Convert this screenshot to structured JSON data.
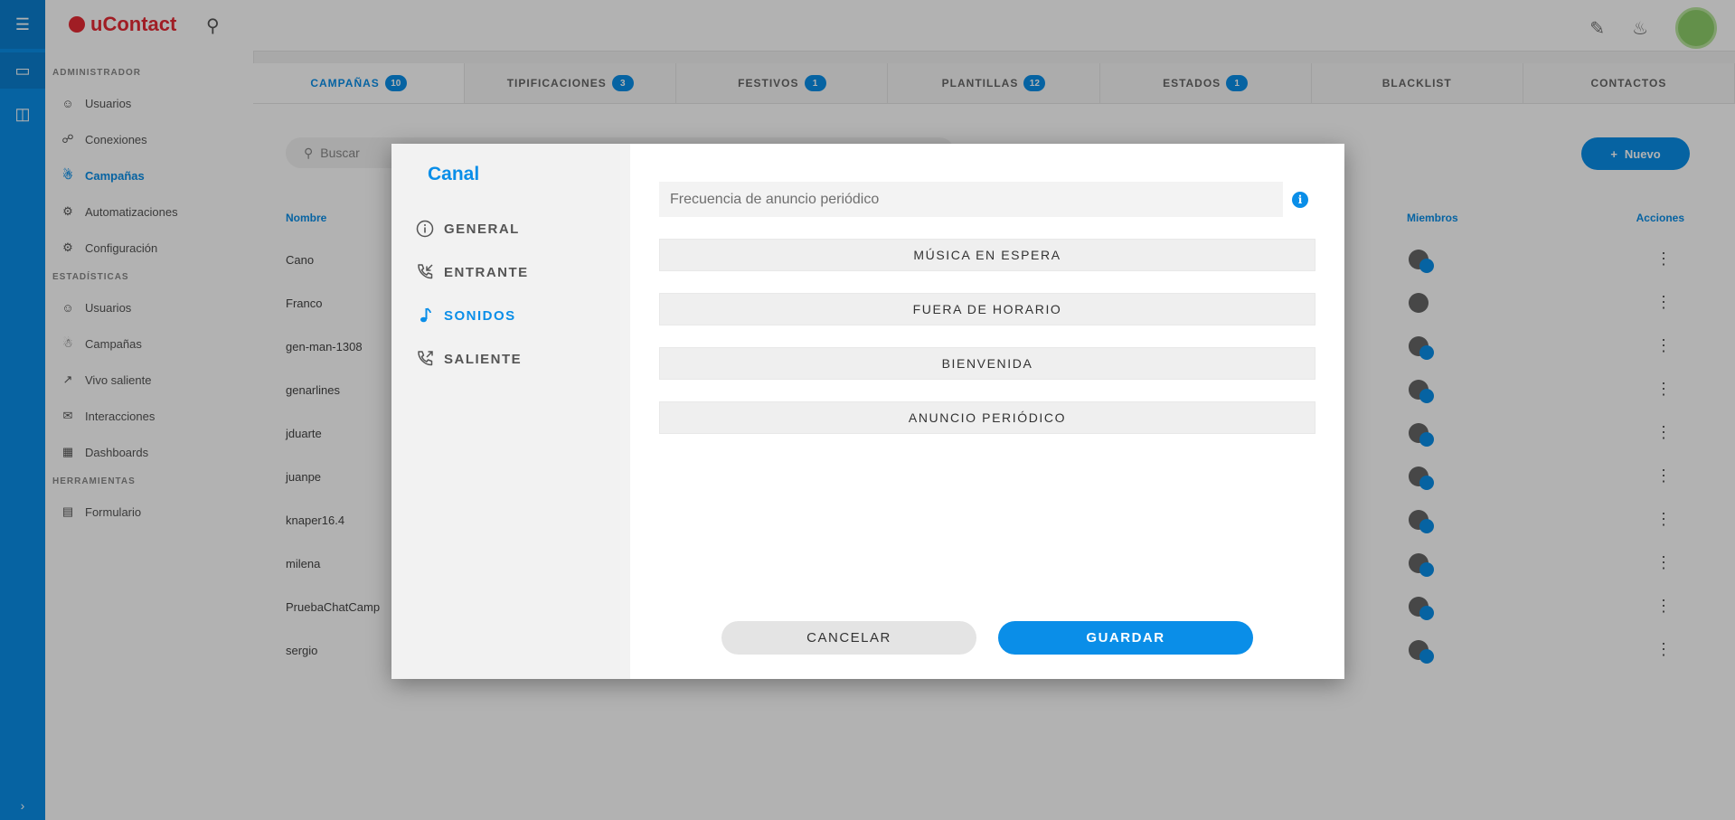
{
  "app": {
    "logo_text": "uContact",
    "rail": [
      "menu-icon",
      "monitor-icon",
      "inbox-icon"
    ],
    "rail_bottom": "expand-icon"
  },
  "sidebar": {
    "sections": [
      {
        "title": "ADMINISTRADOR",
        "items": [
          {
            "label": "Usuarios",
            "icon": "user-icon"
          },
          {
            "label": "Conexiones",
            "icon": "link-icon"
          },
          {
            "label": "Campañas",
            "icon": "campaign-icon",
            "active": true
          },
          {
            "label": "Automatizaciones",
            "icon": "automation-icon"
          },
          {
            "label": "Configuración",
            "icon": "settings-icon"
          }
        ]
      },
      {
        "title": "ESTADÍSTICAS",
        "items": [
          {
            "label": "Usuarios",
            "icon": "user-icon"
          },
          {
            "label": "Campañas",
            "icon": "campaign-icon"
          },
          {
            "label": "Vivo saliente",
            "icon": "outgoing-icon"
          },
          {
            "label": "Interacciones",
            "icon": "interactions-icon"
          },
          {
            "label": "Dashboards",
            "icon": "dashboard-icon"
          }
        ]
      },
      {
        "title": "HERRAMIENTAS",
        "items": [
          {
            "label": "Formulario",
            "icon": "form-icon"
          }
        ]
      }
    ]
  },
  "tabs": [
    {
      "label": "CAMPAÑAS",
      "badge": "10",
      "active": true
    },
    {
      "label": "TIPIFICACIONES",
      "badge": "3"
    },
    {
      "label": "FESTIVOS",
      "badge": "1"
    },
    {
      "label": "PLANTILLAS",
      "badge": "12"
    },
    {
      "label": "ESTADOS",
      "badge": "1"
    },
    {
      "label": "BLACKLIST",
      "badge": ""
    },
    {
      "label": "CONTACTOS",
      "badge": ""
    }
  ],
  "list": {
    "search_placeholder": "Buscar",
    "new_button": "Nuevo",
    "col_name": "Nombre",
    "col_members": "Miembros",
    "col_actions": "Acciones",
    "rows": [
      "Cano",
      "Franco",
      "gen-man-1308",
      "genarlines",
      "jduarte",
      "juanpe",
      "knaper16.4",
      "milena",
      "PruebaChatCamp",
      "sergio"
    ]
  },
  "dialog": {
    "title": "Canal",
    "menu": [
      {
        "label": "GENERAL",
        "icon": "info-circle-icon"
      },
      {
        "label": "ENTRANTE",
        "icon": "incoming-call-icon"
      },
      {
        "label": "SONIDOS",
        "icon": "music-note-icon",
        "active": true
      },
      {
        "label": "SALIENTE",
        "icon": "outgoing-call-icon"
      }
    ],
    "frequency": {
      "placeholder": "Frecuencia de anuncio periódico",
      "value": ""
    },
    "sound_buttons": [
      "MÚSICA EN ESPERA",
      "FUERA DE HORARIO",
      "BIENVENIDA",
      "ANUNCIO PERIÓDICO"
    ],
    "cancel": "CANCELAR",
    "save": "GUARDAR",
    "accent_color": "#0a8ee8"
  }
}
